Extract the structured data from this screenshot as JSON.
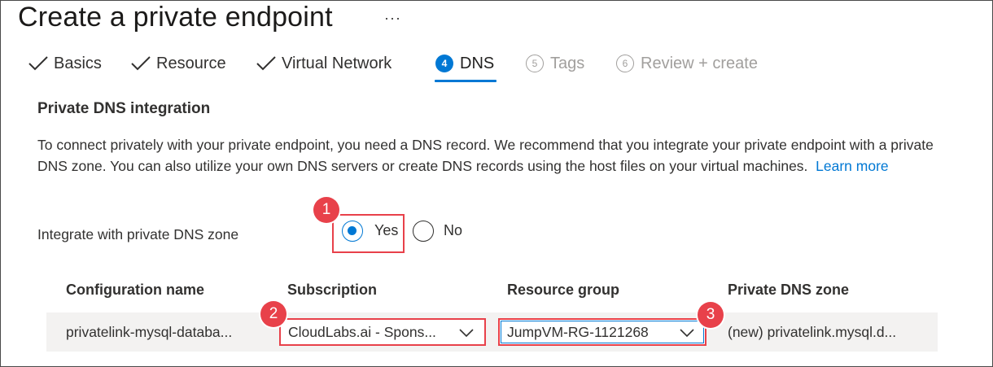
{
  "page": {
    "title": "Create a private endpoint",
    "more": "···"
  },
  "tabs": [
    {
      "label": "Basics",
      "state": "complete",
      "icon": "check-icon"
    },
    {
      "label": "Resource",
      "state": "complete",
      "icon": "check-icon"
    },
    {
      "label": "Virtual Network",
      "state": "complete",
      "icon": "check-icon"
    },
    {
      "label": "DNS",
      "state": "active",
      "number": "4"
    },
    {
      "label": "Tags",
      "state": "disabled",
      "number": "5"
    },
    {
      "label": "Review + create",
      "state": "disabled",
      "number": "6"
    }
  ],
  "section": {
    "title": "Private DNS integration",
    "description": "To connect privately with your private endpoint, you need a DNS record. We recommend that you integrate your private endpoint with a private DNS zone. You can also utilize your own DNS servers or create DNS records using the host files on your virtual machines.",
    "learn_more": "Learn more"
  },
  "integrate": {
    "label": "Integrate with private DNS zone",
    "options": [
      {
        "label": "Yes",
        "selected": true
      },
      {
        "label": "No",
        "selected": false
      }
    ]
  },
  "table": {
    "headers": [
      "Configuration name",
      "Subscription",
      "Resource group",
      "Private DNS zone"
    ],
    "rows": [
      {
        "configuration_name": "privatelink-mysql-databa...",
        "subscription": "CloudLabs.ai - Spons...",
        "resource_group": "JumpVM-RG-1121268",
        "private_dns_zone": "(new) privatelink.mysql.d..."
      }
    ]
  },
  "callouts": [
    "1",
    "2",
    "3"
  ],
  "colors": {
    "accent": "#0078d4",
    "callout": "#e8414a",
    "disabled": "#a19f9d",
    "row_background": "#f3f2f1"
  }
}
